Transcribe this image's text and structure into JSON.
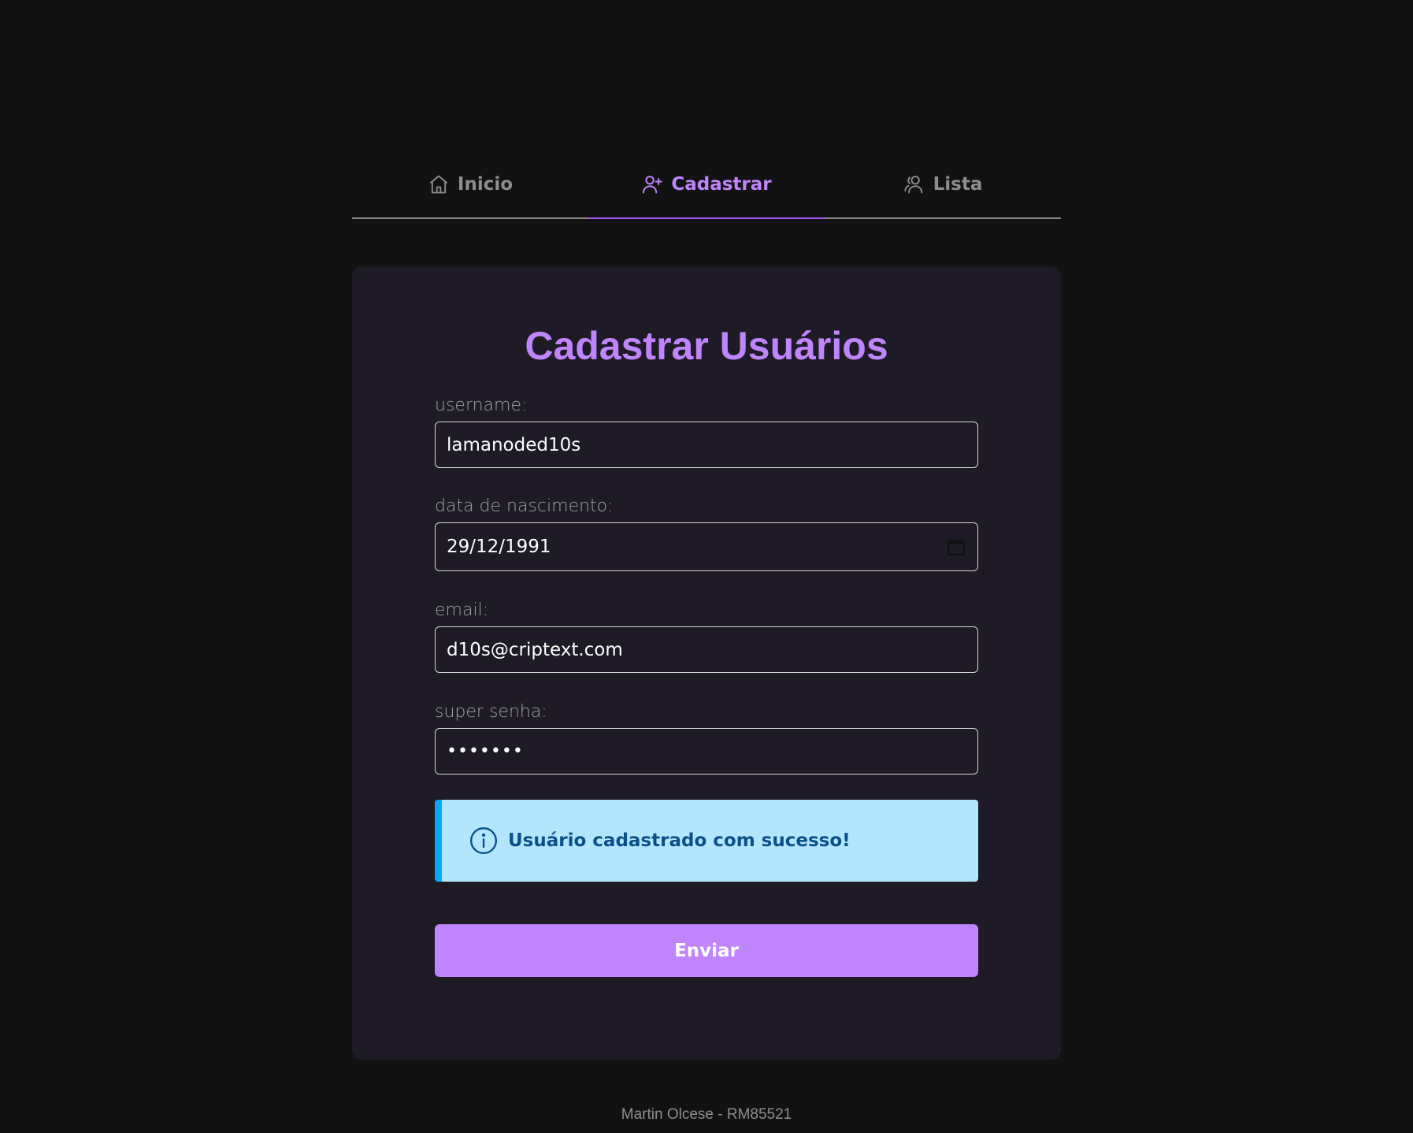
{
  "nav": {
    "tabs": [
      {
        "label": "Inicio",
        "icon": "home-icon",
        "active": false
      },
      {
        "label": "Cadastrar",
        "icon": "user-plus-icon",
        "active": true
      },
      {
        "label": "Lista",
        "icon": "users-icon",
        "active": false
      }
    ]
  },
  "form": {
    "title": "Cadastrar Usuários",
    "fields": {
      "username": {
        "label": "username:",
        "value": "lamanoded10s"
      },
      "birthdate": {
        "label": "data de nascimento:",
        "value": "29/12/1991"
      },
      "email": {
        "label": "email:",
        "value": "d10s@criptext.com"
      },
      "password": {
        "label": "super senha:",
        "value": "•••••••"
      }
    },
    "alert": {
      "text": "Usuário cadastrado com sucesso!",
      "icon": "info-icon"
    },
    "submit_label": "Enviar"
  },
  "footer": {
    "text": "Martin Olcese - RM85521"
  },
  "colors": {
    "background": "#121212",
    "card": "#1e1a26",
    "accent": "#c084fc",
    "alert_bg": "#b3e5fc",
    "alert_border": "#03a9f4",
    "alert_text": "#0b4f8a"
  }
}
